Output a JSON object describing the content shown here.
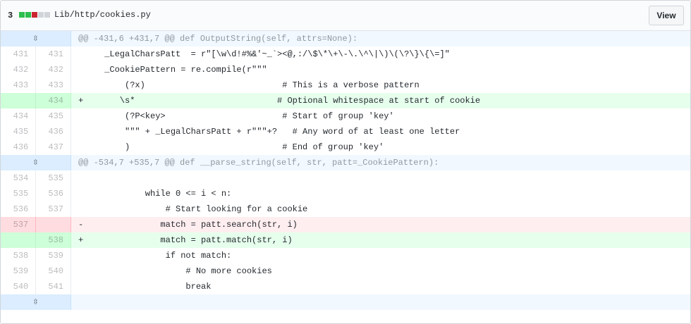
{
  "file": {
    "changes": "3",
    "path": "Lib/http/cookies.py",
    "view_label": "View",
    "diffstat_colors": [
      "#2cbe4e",
      "#2cbe4e",
      "#cb2431",
      "#d1d5da",
      "#d1d5da"
    ]
  },
  "hunks": [
    {
      "header": "@@ -431,6 +431,7 @@ def OutputString(self, attrs=None):"
    },
    {
      "header": "@@ -534,7 +535,7 @@ def __parse_string(self, str, patt=_CookiePattern):"
    }
  ],
  "lines": [
    {
      "old": "431",
      "new": "431",
      "marker": "",
      "code": " _LegalCharsPatt  = r\"[\\w\\d!#%&'~_`><@,:/\\$\\*\\+\\-\\.\\^\\|\\)\\(\\?\\}\\{\\=]\""
    },
    {
      "old": "432",
      "new": "432",
      "marker": "",
      "code": " _CookiePattern = re.compile(r\"\"\""
    },
    {
      "old": "433",
      "new": "433",
      "marker": "",
      "code": "     (?x)                           # This is a verbose pattern"
    },
    {
      "old": "",
      "new": "434",
      "marker": "+",
      "code": "    \\s*                            # Optional whitespace at start of cookie"
    },
    {
      "old": "434",
      "new": "435",
      "marker": "",
      "code": "     (?P<key>                       # Start of group 'key'"
    },
    {
      "old": "435",
      "new": "436",
      "marker": "",
      "code": "     \"\"\" + _LegalCharsPatt + r\"\"\"+?   # Any word of at least one letter"
    },
    {
      "old": "436",
      "new": "437",
      "marker": "",
      "code": "     )                              # End of group 'key'"
    },
    {
      "old": "534",
      "new": "535",
      "marker": "",
      "code": ""
    },
    {
      "old": "535",
      "new": "536",
      "marker": "",
      "code": "         while 0 <= i < n:"
    },
    {
      "old": "536",
      "new": "537",
      "marker": "",
      "code": "             # Start looking for a cookie"
    },
    {
      "old": "537",
      "new": "",
      "marker": "-",
      "code": "            match = patt.search(str, i)"
    },
    {
      "old": "",
      "new": "538",
      "marker": "+",
      "code": "            match = patt.match(str, i)"
    },
    {
      "old": "538",
      "new": "539",
      "marker": "",
      "code": "             if not match:"
    },
    {
      "old": "539",
      "new": "540",
      "marker": "",
      "code": "                 # No more cookies"
    },
    {
      "old": "540",
      "new": "541",
      "marker": "",
      "code": "                 break"
    }
  ]
}
